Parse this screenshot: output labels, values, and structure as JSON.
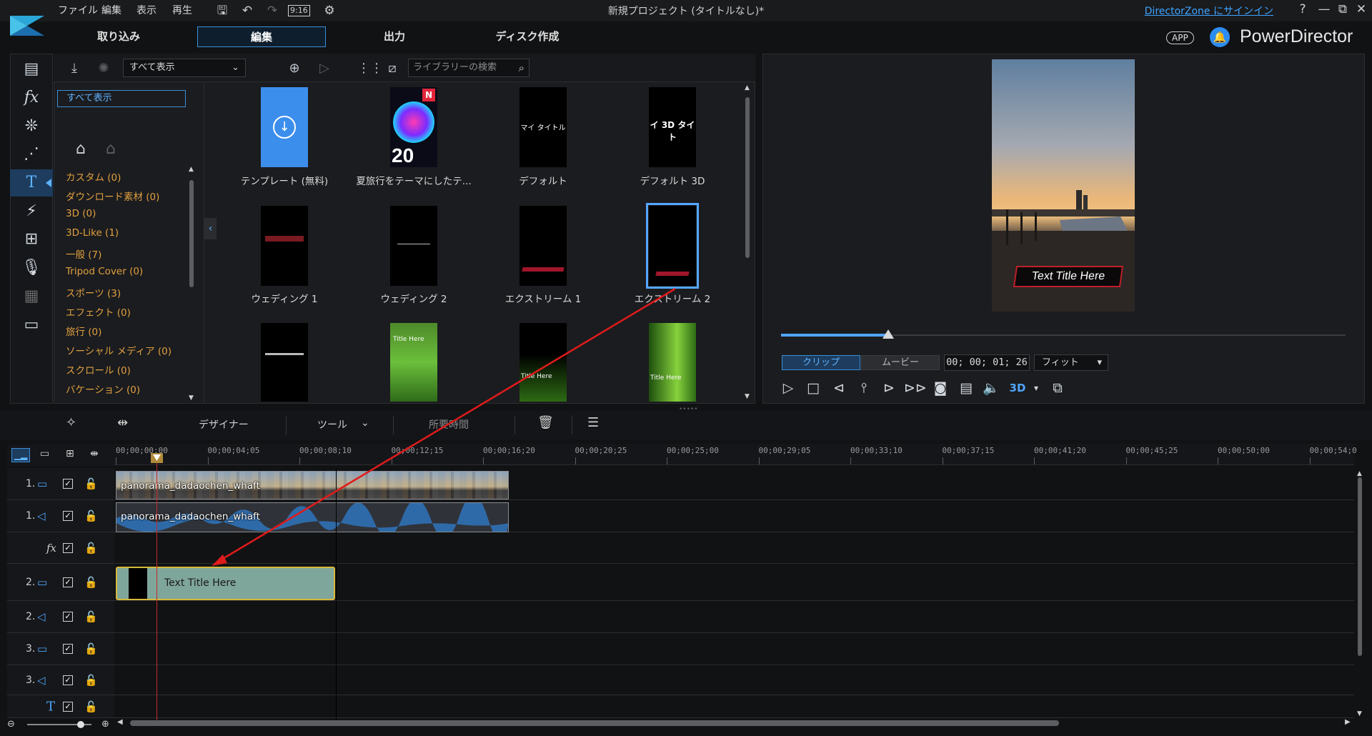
{
  "menu": [
    "ファイル",
    "編集",
    "表示",
    "再生"
  ],
  "toolbar": {
    "aspect": "9:16"
  },
  "window": {
    "title": "新規プロジェクト (タイトルなし)*",
    "signin": "DirectorZone にサインイン",
    "help": "?",
    "minimize": "—",
    "restore": "⧉",
    "close": "✕"
  },
  "mode_tabs": [
    "取り込み",
    "編集",
    "出力",
    "ディスク作成"
  ],
  "brand": {
    "app_badge": "APP",
    "name": "PowerDirector",
    "accent": "#2d8cf0"
  },
  "library": {
    "filter": "すべて表示",
    "search_placeholder": "ライブラリーの検索",
    "category_selected": "すべて表示",
    "categories": [
      "カスタム (0)",
      "ダウンロード素材 (0)",
      "3D (0)",
      "3D-Like (1)",
      "一般 (7)",
      "Tripod Cover (0)",
      "スポーツ (3)",
      "エフェクト (0)",
      "旅行 (0)",
      "ソーシャル メディア (0)",
      "スクロール (0)",
      "バケーション (0)"
    ],
    "templates": [
      {
        "label": "テンプレート (無料)",
        "thumb": "download"
      },
      {
        "label": "夏旅行をテーマにしたテ...",
        "thumb": "summer",
        "badge": "N",
        "year": "20"
      },
      {
        "label": "デフォルト",
        "thumb": "default",
        "text": "マイ タイトル"
      },
      {
        "label": "デフォルト 3D",
        "thumb": "default3d",
        "text": "イ 3D タイト"
      },
      {
        "label": "ウェディング 1",
        "thumb": "wedding1"
      },
      {
        "label": "ウェディング 2",
        "thumb": "wedding2"
      },
      {
        "label": "エクストリーム 1",
        "thumb": "extreme1"
      },
      {
        "label": "エクストリーム 2",
        "thumb": "extreme2",
        "selected": true
      },
      {
        "label": "",
        "thumb": "dark"
      },
      {
        "label": "",
        "thumb": "green",
        "text": "Title Here"
      },
      {
        "label": "",
        "thumb": "greendark",
        "text": "Title Here"
      },
      {
        "label": "",
        "thumb": "greenswirl",
        "text": "Title Here"
      }
    ]
  },
  "preview": {
    "overlay_text": "Text Title Here",
    "mode_clip": "クリップ",
    "mode_movie": "ムービー",
    "timecode": "00; 00; 01; 26",
    "fit": "フィット",
    "progress": 0.19
  },
  "mid_toolbar": {
    "designer": "デザイナー",
    "tools": "ツール",
    "duration": "所要時間"
  },
  "timeline": {
    "ticks": [
      "00;00;00;00",
      "00;00;04;05",
      "00;00;08;10",
      "00;00;12;15",
      "00;00;16;20",
      "00;00;20;25",
      "00;00;25;00",
      "00;00;29;05",
      "00;00;33;10",
      "00;00;37;15",
      "00;00;41;20",
      "00;00;45;25",
      "00;00;50;00",
      "00;00;54;0"
    ],
    "tracks": [
      {
        "num": "1.",
        "type": "video"
      },
      {
        "num": "1.",
        "type": "audio"
      },
      {
        "num": "",
        "type": "fx"
      },
      {
        "num": "2.",
        "type": "video"
      },
      {
        "num": "2.",
        "type": "audio"
      },
      {
        "num": "3.",
        "type": "video"
      },
      {
        "num": "3.",
        "type": "audio"
      },
      {
        "num": "",
        "type": "title"
      }
    ],
    "clips": {
      "video": "panorama_dadaochen_whaft",
      "audio": "panorama_dadaochen_whaft",
      "title": "Text Title Here"
    }
  }
}
